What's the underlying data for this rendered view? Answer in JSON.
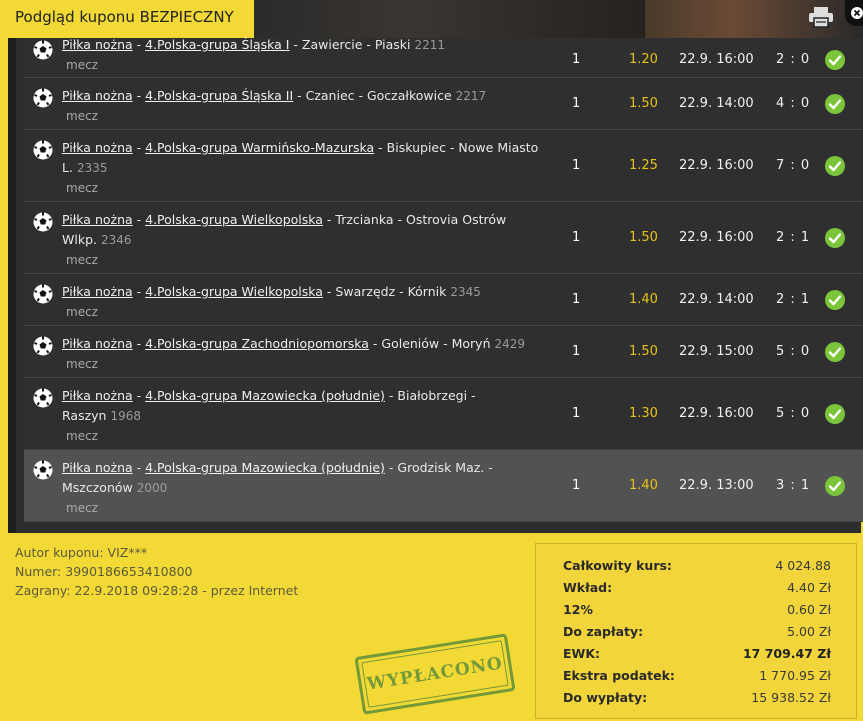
{
  "header": {
    "title": "Podgląd kuponu BEZPIECZNY"
  },
  "bets": [
    {
      "sport": "Piłka nożna",
      "league": "4.Polska-grupa Śląska I",
      "match": "Zawiercie - Piaski",
      "id": "2211",
      "kind": "mecz",
      "bet": "1",
      "odds": "1.20",
      "date": "22.9. 16:00",
      "score": "2 : 0"
    },
    {
      "sport": "Piłka nożna",
      "league": "4.Polska-grupa Śląska II",
      "match": "Czaniec - Goczałkowice",
      "id": "2217",
      "kind": "mecz",
      "bet": "1",
      "odds": "1.50",
      "date": "22.9. 14:00",
      "score": "4 : 0"
    },
    {
      "sport": "Piłka nożna",
      "league": "4.Polska-grupa Warmińsko-Mazurska",
      "match": "Biskupiec - Nowe Miasto L.",
      "id": "2335",
      "kind": "mecz",
      "bet": "1",
      "odds": "1.25",
      "date": "22.9. 16:00",
      "score": "7 : 0"
    },
    {
      "sport": "Piłka nożna",
      "league": "4.Polska-grupa Wielkopolska",
      "match": "Trzcianka - Ostrovia Ostrów Wlkp.",
      "id": "2346",
      "kind": "mecz",
      "bet": "1",
      "odds": "1.50",
      "date": "22.9. 16:00",
      "score": "2 : 1"
    },
    {
      "sport": "Piłka nożna",
      "league": "4.Polska-grupa Wielkopolska",
      "match": "Swarzędz - Kórnik",
      "id": "2345",
      "kind": "mecz",
      "bet": "1",
      "odds": "1.40",
      "date": "22.9. 14:00",
      "score": "2 : 1"
    },
    {
      "sport": "Piłka nożna",
      "league": "4.Polska-grupa Zachodniopomorska",
      "match": "Goleniów - Moryń",
      "id": "2429",
      "kind": "mecz",
      "bet": "1",
      "odds": "1.50",
      "date": "22.9. 15:00",
      "score": "5 : 0"
    },
    {
      "sport": "Piłka nożna",
      "league": "4.Polska-grupa Mazowiecka (południe)",
      "match": "Białobrzegi - Raszyn",
      "id": "1968",
      "kind": "mecz",
      "bet": "1",
      "odds": "1.30",
      "date": "22.9. 16:00",
      "score": "5 : 0"
    },
    {
      "sport": "Piłka nożna",
      "league": "4.Polska-grupa Mazowiecka (południe)",
      "match": "Grodzisk Maz. - Mszczonów",
      "id": "2000",
      "kind": "mecz",
      "bet": "1",
      "odds": "1.40",
      "date": "22.9. 13:00",
      "score": "3 : 1"
    }
  ],
  "meta": {
    "author": "Autor kuponu: VIZ***",
    "number": "Numer: 3990186653410800",
    "played": "Zagrany: 22.9.2018 09:28:28 - przez Internet"
  },
  "stamp": "WYPŁACONO",
  "summary": {
    "total_odds_label": "Całkowity kurs:",
    "total_odds": "4 024.88",
    "stake_label": "Wkład:",
    "stake": "4.40 Zł",
    "tax_label": "12%",
    "tax": "0.60 Zł",
    "to_pay_label": "Do zapłaty:",
    "to_pay": "5.00 Zł",
    "ewk_label": "EWK:",
    "ewk": "17 709.47 Zł",
    "extra_tax_label": "Ekstra podatek:",
    "extra_tax": "1 770.95 Zł",
    "payout_label": "Do wypłaty:",
    "payout": "15 938.52 Zł"
  },
  "colors": {
    "accent": "#f3d936",
    "odds": "#e6c21a",
    "check": "#7cc53a"
  }
}
